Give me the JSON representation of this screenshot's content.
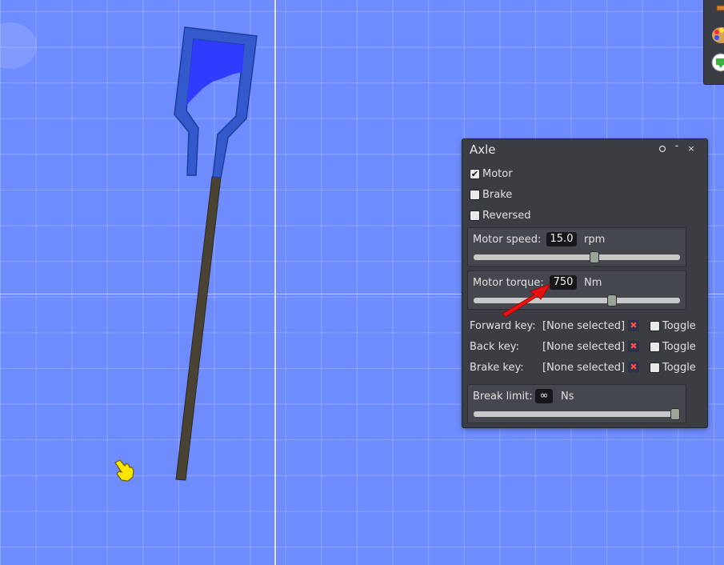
{
  "panel": {
    "title": "Axle",
    "pin_icon": "pin-icon",
    "minimize_glyph": "-",
    "close_glyph": "×",
    "checkboxes": [
      {
        "label": "Motor",
        "checked": true
      },
      {
        "label": "Brake",
        "checked": false
      },
      {
        "label": "Reversed",
        "checked": false
      }
    ],
    "motor_speed": {
      "label": "Motor speed:",
      "value": "15.0",
      "unit": "rpm",
      "slider_fraction": 0.59
    },
    "motor_torque": {
      "label": "Motor torque:",
      "value": "750",
      "unit": "Nm",
      "slider_fraction": 0.68
    },
    "keys": [
      {
        "label": "Forward key:",
        "value": "[None selected]",
        "toggle_label": "Toggle",
        "toggle_checked": false
      },
      {
        "label": "Back key:",
        "value": "[None selected]",
        "toggle_label": "Toggle",
        "toggle_checked": false
      },
      {
        "label": "Brake key:",
        "value": "[None selected]",
        "toggle_label": "Toggle",
        "toggle_checked": false
      }
    ],
    "break_limit": {
      "label": "Break limit:",
      "value": "∞",
      "unit": "Ns",
      "slider_fraction": 1.0
    }
  },
  "toolbar": {
    "buttons": [
      "box-tool-icon",
      "palette-icon",
      "scene-icon"
    ]
  },
  "colors": {
    "background": "#6f8cff",
    "container": "#2f55c8",
    "water": "#2f3bff",
    "rod": "#4a4232",
    "annotation_arrow": "#e81010",
    "cursor": "#ffe600"
  }
}
